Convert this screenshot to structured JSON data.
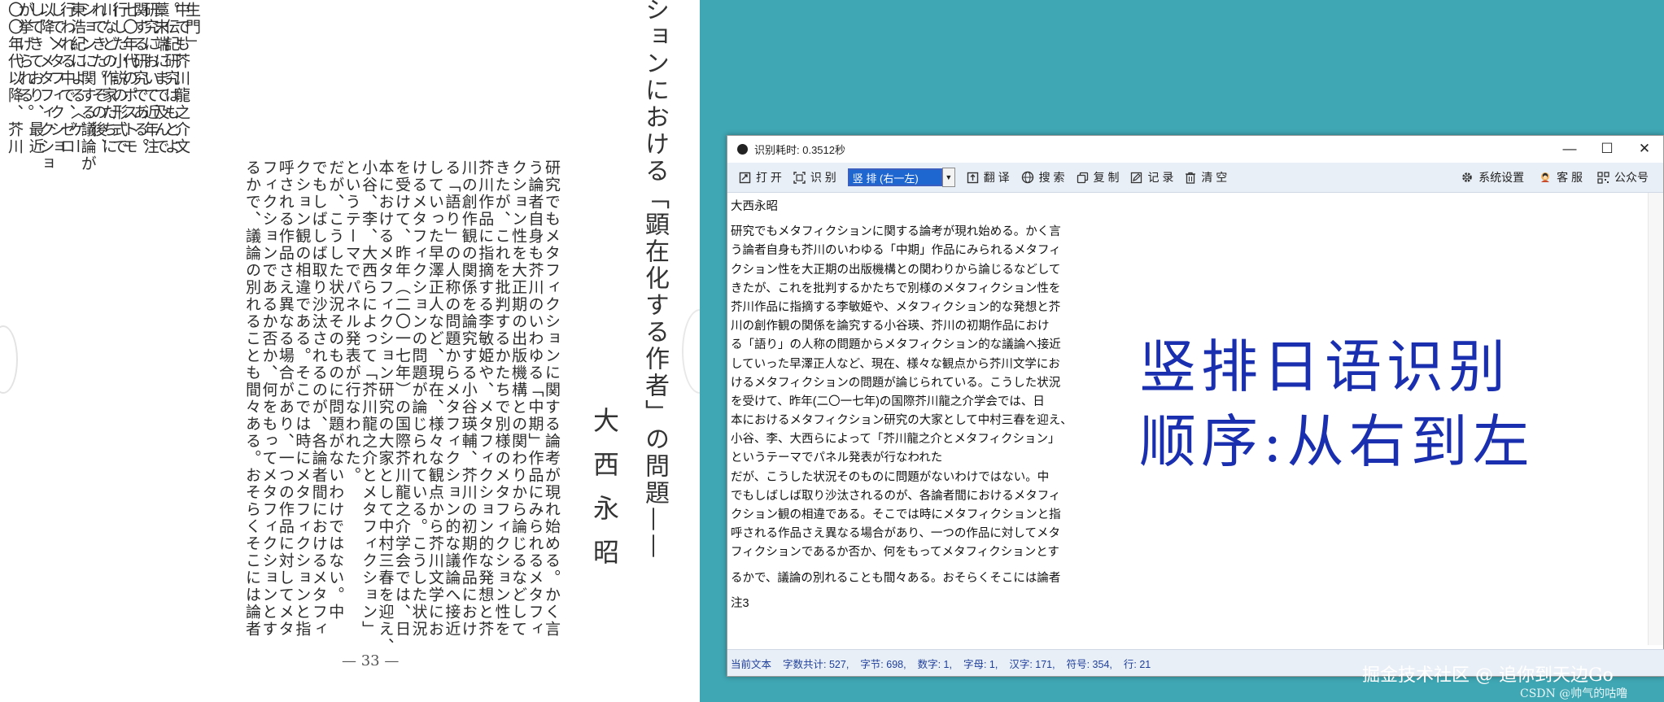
{
  "scan": {
    "chapter_title": "ションにおける「顕在化する作者」の問題——",
    "author": "大西永昭",
    "page_number": "— 33 —",
    "left_page_columns": [
      "生門」",
      "中でも芥川龍之介文",
      "。伝記研究はもとよ",
      "藁末端にまで及んで",
      "研究において近年注",
      "関する研究である。",
      "七〇年代のポストモ",
      "行した小説の形式で",
      "川などの作家たちに",
      "れてきた。その後、",
      "ションに関する議論が",
      "東浩紀による〈ゲー",
      "行われる中で、ゼロ",
      "してメタフィクショ",
      "以降、メタフィクショ",
      "してきており、最近",
      "が挙げられる。",
      "〇〇年代以降、芥川"
    ],
    "right_page_columns": [
      "研究でもメタフィクションに関する論考が現れ始める。かく言",
      "う論者自身も芥川のいわゆる「中期」作品にみられるメタフィ",
      "クション性を大正期の出版機構との関わりから論じるなどして",
      "きたが、これを批判するかたちで別様のメタフィクション性を",
      "芥川作品に指摘する李敏姫や、メタフィクション的な発想と芥",
      "川の創作観の関係を論究する小谷瑛輔、芥川の初期作品におけ",
      "る「語り」の人称の問題からメタフィクション的な議論へ接近",
      "していった早澤正人など、現在、様々な観点から芥川文学にお",
      "けるメタフィクションの問題が論じられている。こうした状況",
      "を受けて、昨年（二〇一七年）の国際芥川龍之介学会では、日",
      "本におけるメタフィクション研究の大家として中村三春を迎え、",
      "小谷、李、大西らによって「芥川龍之介とメタフィクション」",
      "というテーマでパネル発表が行なわれた。",
      "だが、こうした状況そのものに問題がないわけではない。中",
      "でもしばしば取り沙汰されるのが、各論者間におけるメタフィ",
      "クション観の相違である。そこでは時にメタフィクションと指",
      "呼される作品さえ異なる場合があり、一つの作品に対してメタ",
      "フィクションであるか否か、何をもってメタフィクションとす",
      "るかで、議論の別れることも間々ある。おそらくそこには論者"
    ]
  },
  "window": {
    "title": "识别耗时: 0.3512秒",
    "controls": {
      "minimize": "—",
      "maximize": "☐",
      "close": "✕"
    },
    "toolbar": {
      "open": "打 开",
      "recognize": "识 别",
      "mode_selected": "竖 排 (右一左)",
      "translate": "翻 译",
      "search": "搜 索",
      "copy": "复 制",
      "record": "记 录",
      "clear": "清 空",
      "settings": "系统设置",
      "support": "客 服",
      "official_account": "公众号"
    },
    "content_lines": [
      "大西永昭",
      "",
      "研究でもメタフィクションに関する論考が現れ始める。かく言",
      "う論者自身も芥川のいわゆる「中期」作品にみられるメタフィ",
      "クション性を大正期の出版機構との関わりから論じるなどして",
      "きたが、これを批判するかたちで別様のメタフィクション性を",
      "芥川作品に指摘する李敏姫や、メタフィクション的な発想と芥",
      "川の創作観の関係を論究する小谷瑛、芥川の初期作品におけ",
      "る「語り」の人称の問題からメタフィクション的な議論へ接近",
      "していった早澤正人など、現在、様々な観点から芥川文学にお",
      "けるメタフィクションの問題が論じられている。こうした状況",
      "を受けて、昨年(二〇一七年)の国際芥川龍之介学会では、日",
      "本におけるメタフィクション研究の大家として中村三春を迎え、",
      "小谷、李、大西らによって「芥川龍之介とメタフィクション」",
      "というテーマでパネル発表が行なわれた",
      "だが、こうした状況そのものに問題がないわけではない。中",
      "でもしばしば取り沙汰されるのが、各論者間におけるメタフィ",
      "クション観の相違である。そこでは時にメタフィクションと指",
      "呼される作品さえ異なる場合があり、一つの作品に対してメタ",
      "フィクションであるか否か、何をもってメタフィクションとす",
      "",
      "るかで、議論の別れることも間々ある。おそらくそこには論者",
      "",
      "注3"
    ],
    "status": {
      "label": "当前文本",
      "chars": "字数共计: 527,",
      "bytes": "字节: 698,",
      "digits": "数字: 1,",
      "letters": "字母: 1,",
      "hanzi": "汉字: 171,",
      "symbols": "符号: 354,",
      "lines": "行: 21"
    }
  },
  "overlay": {
    "line1": "竖排日语识别",
    "line2": "顺序:从右到左"
  },
  "watermarks": {
    "juejin": "掘金技术社区 @ 追你到天边Go",
    "csdn": "CSDN @帅气的咕噜"
  },
  "colors": {
    "desktop": "#3fa6b3",
    "accent": "#1e66d0",
    "overlay_text": "#1a2fb0",
    "status_text": "#1e3f9a"
  }
}
